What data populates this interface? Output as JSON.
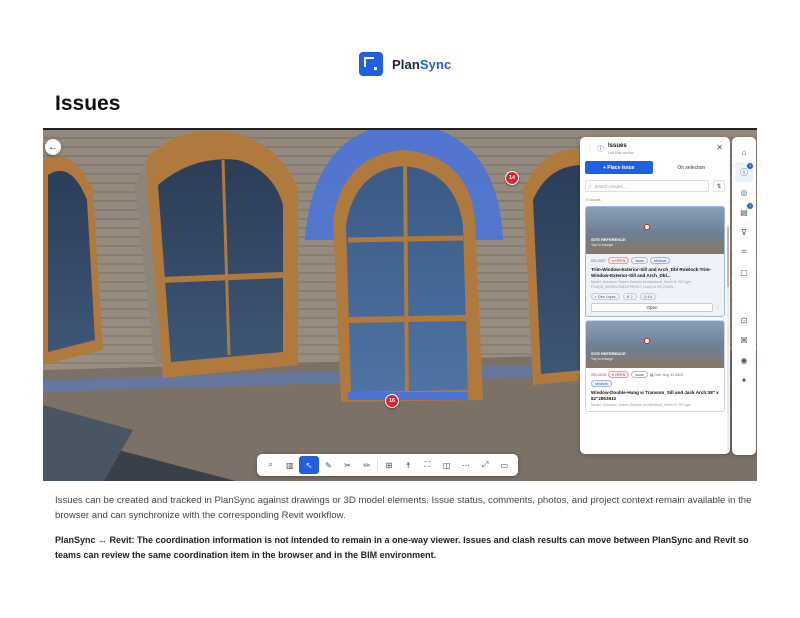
{
  "brand": {
    "name_part1": "Plan",
    "name_part2": "Sync",
    "color": "#1f5fe0"
  },
  "page": {
    "title": "Issues"
  },
  "viewer": {
    "pins": [
      {
        "label": "14"
      },
      {
        "label": "16"
      }
    ],
    "toolbar": {
      "buttons": [
        {
          "name": "search-icon",
          "glyph": "⌕"
        },
        {
          "name": "chart-icon",
          "glyph": "▥"
        },
        {
          "name": "cursor-icon",
          "glyph": "↖",
          "active": true
        },
        {
          "name": "measure-icon",
          "glyph": "✎"
        },
        {
          "name": "scissors-icon",
          "glyph": "✂"
        },
        {
          "name": "pen-icon",
          "glyph": "✏"
        },
        {
          "name": "grid-icon",
          "glyph": "⊞"
        },
        {
          "name": "person-icon",
          "glyph": "☨"
        },
        {
          "name": "frame-icon",
          "glyph": "⛶"
        },
        {
          "name": "split-icon",
          "glyph": "◫"
        },
        {
          "name": "more-icon",
          "glyph": "⋯"
        },
        {
          "name": "expand-icon",
          "glyph": "⤢"
        },
        {
          "name": "display-icon",
          "glyph": "▭"
        }
      ]
    }
  },
  "issues_panel": {
    "title": "Issues",
    "subtitle": "List this model",
    "place_issue_label": "+ Place issue",
    "on_selection_label": "On selection",
    "search_placeholder": "Search issues...",
    "count_label": "5 issues",
    "cards": [
      {
        "thumb_ref": "SITE REFERENCE",
        "thumb_tap": "Tap to enlarge",
        "id": "ISS-0027",
        "status": "● OPEN",
        "tag2": "Issue",
        "tag3": "Minimal",
        "title": "Trim-Window-Exterior-Sill and Arch_Dbl Rowlock:Trim-Window-Exterior-Sill and Arch_Dbl...",
        "meta": "Model: Snowdon Towers Sample Architectural_North III, RC type FCAQS_DMGELEMENTPROXY Level L4 RC (GUID...",
        "chip1": "◐ Dee Lopez",
        "chip2": "⊘ 2",
        "chip3": "◷ 14",
        "open_label": "Open"
      },
      {
        "thumb_ref": "SITE REFERENCE",
        "thumb_tap": "Tap to enlarge",
        "id": "ISS-0028",
        "status": "● OPEN",
        "tag2": "Issue",
        "date": "▦ Due: Aug 31 2024",
        "tag3": "Medium",
        "title": "Window-Double-Hung w Transom_Sill and Jack Arch:38\" x 82\"2853932",
        "meta": "Model: Snowdon Towers Sample Architectural_North III, RC type"
      }
    ]
  },
  "rail": {
    "buttons": [
      {
        "name": "home-icon",
        "glyph": "⌂"
      },
      {
        "name": "issues-icon",
        "glyph": "ⓘ",
        "badge": "4",
        "active": true
      },
      {
        "name": "clash-icon",
        "glyph": "◎"
      },
      {
        "name": "sheets-icon",
        "glyph": "▤",
        "badge": "3"
      },
      {
        "name": "filter-icon",
        "glyph": "⊽"
      },
      {
        "name": "crop-icon",
        "glyph": "⌗"
      },
      {
        "name": "clipboard-icon",
        "glyph": "▢"
      },
      {
        "name": "scan-icon",
        "glyph": "⊡"
      },
      {
        "name": "hierarchy-icon",
        "glyph": "⌘"
      },
      {
        "name": "eye-icon",
        "glyph": "◉"
      },
      {
        "name": "sparkle-icon",
        "glyph": "✦"
      }
    ]
  },
  "text": {
    "description": "Issues can be created and tracked in PlanSync against drawings or 3D model elements. Issue status, comments, photos, and project context remain available in the browser and can synchronize with the corresponding Revit workflow.",
    "note": "PlanSync ↔ Revit: The coordination information is not intended to remain in a one-way viewer. Issues and clash results can move between PlanSync and Revit so teams can review the same coordination item in the browser and in the BIM environment."
  }
}
